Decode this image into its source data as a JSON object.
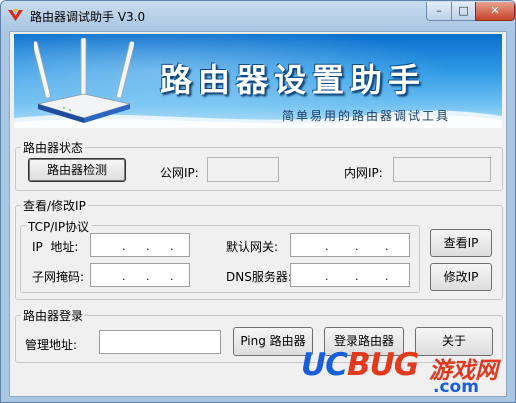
{
  "window": {
    "title": "路由器调试助手 V3.0",
    "controls": {
      "minimize": "–",
      "maximize": "□",
      "close": "✕"
    }
  },
  "banner": {
    "title": "路由器设置助手",
    "subtitle": "简单易用的路由器调试工具"
  },
  "status_group": {
    "title": "路由器状态",
    "detect_button": "路由器检测",
    "wan_ip_label": "公网IP:",
    "wan_ip_value": "",
    "lan_ip_label": "内网IP:",
    "lan_ip_value": ""
  },
  "ip_group": {
    "title": "查看/修改IP",
    "tcpip_title": "TCP/IP协议",
    "ip_label": "IP  地址:",
    "mask_label": "子网掩码:",
    "gateway_label": "默认网关:",
    "dns_label": "DNS服务器:",
    "ip_dot": ".",
    "view_ip_button": "查看IP",
    "modify_ip_button": "修改IP"
  },
  "login_group": {
    "title": "路由器登录",
    "admin_addr_label": "管理地址:",
    "admin_addr_value": "",
    "ping_button": "Ping 路由器",
    "login_button": "登录路由器",
    "about_button": "关于"
  },
  "watermark": {
    "uc": "UC",
    "bug": "BUG",
    "cn": "游戏网",
    "com": ".com"
  },
  "colors": {
    "titlebar": "#a9c6e3",
    "banner_top": "#0a6fcc",
    "banner_bottom": "#bfe4fa",
    "watermark_blue": "#1b5fd8",
    "watermark_red": "#e23a1e"
  }
}
